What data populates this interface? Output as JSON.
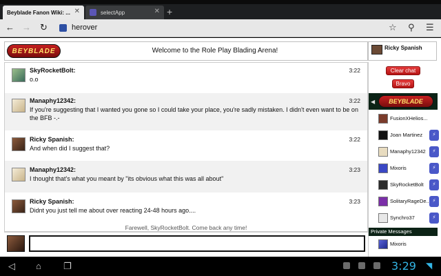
{
  "browser": {
    "tabs": [
      {
        "label": "Beyblade Fanon Wiki: ...",
        "active": true
      },
      {
        "label": "selectApp",
        "active": false
      }
    ],
    "new_tab": "+",
    "url": "herover"
  },
  "header": {
    "logo_text": "BEYBLADE",
    "title": "Welcome to the Role Play Blading Arena!",
    "current_user": "Ricky Spanish"
  },
  "messages": [
    {
      "name": "SkyRocketBolt:",
      "text": "o.o",
      "time": "3:22",
      "avatar": "sky"
    },
    {
      "name": "Manaphy12342:",
      "text": "If you're suggesting that I wanted you gone so I could take your place, you're sadly mistaken. I didn't even want to be on the BFB -.-",
      "time": "3:22",
      "avatar": "mana"
    },
    {
      "name": "Ricky Spanish:",
      "text": "And when did I suggest that?",
      "time": "3:22",
      "avatar": "ricky"
    },
    {
      "name": "Manaphy12342:",
      "text": "I thought that's what you meant by \"its obvious what this was all about\"",
      "time": "3:23",
      "avatar": "mana"
    },
    {
      "name": "Ricky Spanish:",
      "text": "Didnt you just tell me about over reacting 24-48 hours ago....",
      "time": "3:23",
      "avatar": "ricky"
    }
  ],
  "farewell": "Farewell, SkyRocketBolt. Come back any time!",
  "sidebar": {
    "clear_chat": "Clear chat",
    "bravo": "Bravo",
    "users": [
      {
        "name": "FusionXHelios...",
        "badge": false,
        "color": "#7a3b2b"
      },
      {
        "name": "Joan Martinez",
        "badge": true,
        "color": "#111111"
      },
      {
        "name": "Manaphy12342",
        "badge": true,
        "color": "#e8dcc0"
      },
      {
        "name": "Mixoris",
        "badge": true,
        "color": "#3a47c4"
      },
      {
        "name": "SkyRocketBolt",
        "badge": true,
        "color": "#2b2b2b"
      },
      {
        "name": "SolitaryRageDe...",
        "badge": true,
        "color": "#7b2fa8"
      },
      {
        "name": "Synchro37",
        "badge": true,
        "color": "#e8e8e8"
      }
    ],
    "private_messages": "Private Messages",
    "pm_user": "Mixoris"
  },
  "system": {
    "clock": "3:29"
  }
}
